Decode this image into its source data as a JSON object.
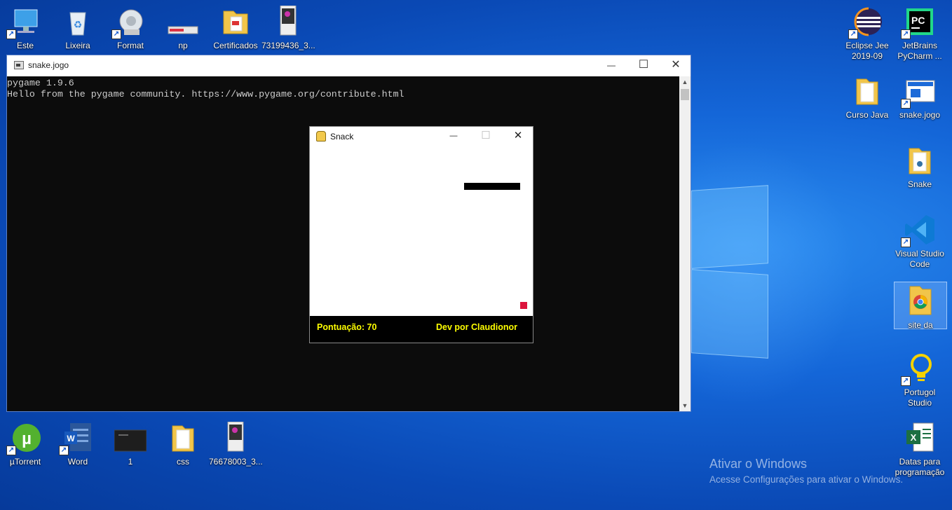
{
  "desktop": {
    "icons_top": [
      {
        "label": "Este Computador",
        "icon": "computer-icon"
      },
      {
        "label": "Lixeira",
        "icon": "recycle-bin-icon"
      },
      {
        "label": "Format Factory",
        "icon": "format-factory-icon"
      },
      {
        "label": "np",
        "icon": "image-file-icon"
      },
      {
        "label": "Certificados",
        "icon": "folder-icon"
      },
      {
        "label": "73199436_3...",
        "icon": "photo-file-icon"
      }
    ],
    "icons_right": [
      {
        "label": "Eclipse Jee 2019-09",
        "icon": "eclipse-icon"
      },
      {
        "label": "JetBrains PyCharm ...",
        "icon": "pycharm-icon"
      },
      {
        "label": "Curso Java",
        "icon": "folder-icon"
      },
      {
        "label": "snake.jogo",
        "icon": "python-file-icon"
      },
      {
        "label": "Snake",
        "icon": "folder-icon"
      },
      {
        "label": "Visual Studio Code",
        "icon": "vscode-icon"
      },
      {
        "label": "site da",
        "icon": "chrome-file-icon"
      },
      {
        "label": "Portugol Studio",
        "icon": "lightbulb-icon"
      },
      {
        "label": "Datas para programação",
        "icon": "excel-icon"
      }
    ],
    "icons_bottom": [
      {
        "label": "µTorrent",
        "icon": "utorrent-icon"
      },
      {
        "label": "Word",
        "icon": "word-icon"
      },
      {
        "label": "1",
        "icon": "video-file-icon"
      },
      {
        "label": "css",
        "icon": "folder-icon"
      },
      {
        "label": "76678003_3...",
        "icon": "photo-file-icon"
      }
    ],
    "watermark_title": "Ativar o Windows",
    "watermark_sub": "Acesse Configurações para ativar o Windows."
  },
  "console": {
    "title": "snake.jogo",
    "line1": "pygame 1.9.6",
    "line2": "Hello from the pygame community. https://www.pygame.org/contribute.html",
    "minimize": "—",
    "maximize": "☐",
    "close": "✕"
  },
  "game": {
    "title": "Snack",
    "minimize": "—",
    "maximize": "☐",
    "close": "✕",
    "score_text": "Pontuação: 70",
    "credit_text": "Dev por Claudionor",
    "snake_length": 8,
    "colors": {
      "snake": "#000000",
      "food": "#dc143c",
      "hud_text": "#ffff00",
      "hud_bg": "#000000"
    }
  }
}
